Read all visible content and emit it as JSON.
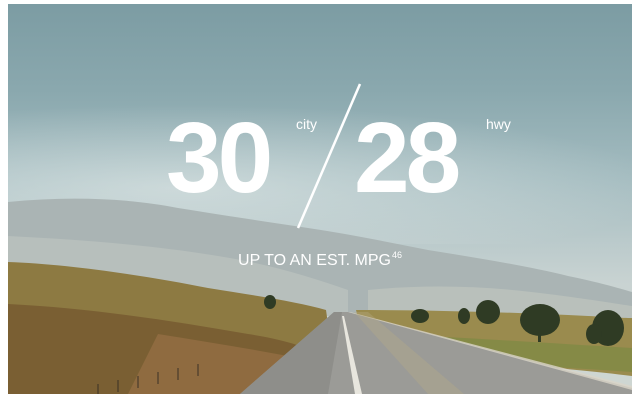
{
  "hero": {
    "city_mpg": "30",
    "city_label": "city",
    "hwy_mpg": "28",
    "hwy_label": "hwy",
    "tagline": "UP TO AN EST. MPG",
    "footnote": "46"
  },
  "colors": {
    "text": "#ffffff",
    "sky_top": "#7c9ca3",
    "sky_bottom": "#cfd6d2",
    "field": "#8e7a3f",
    "road": "#9a9a96"
  }
}
